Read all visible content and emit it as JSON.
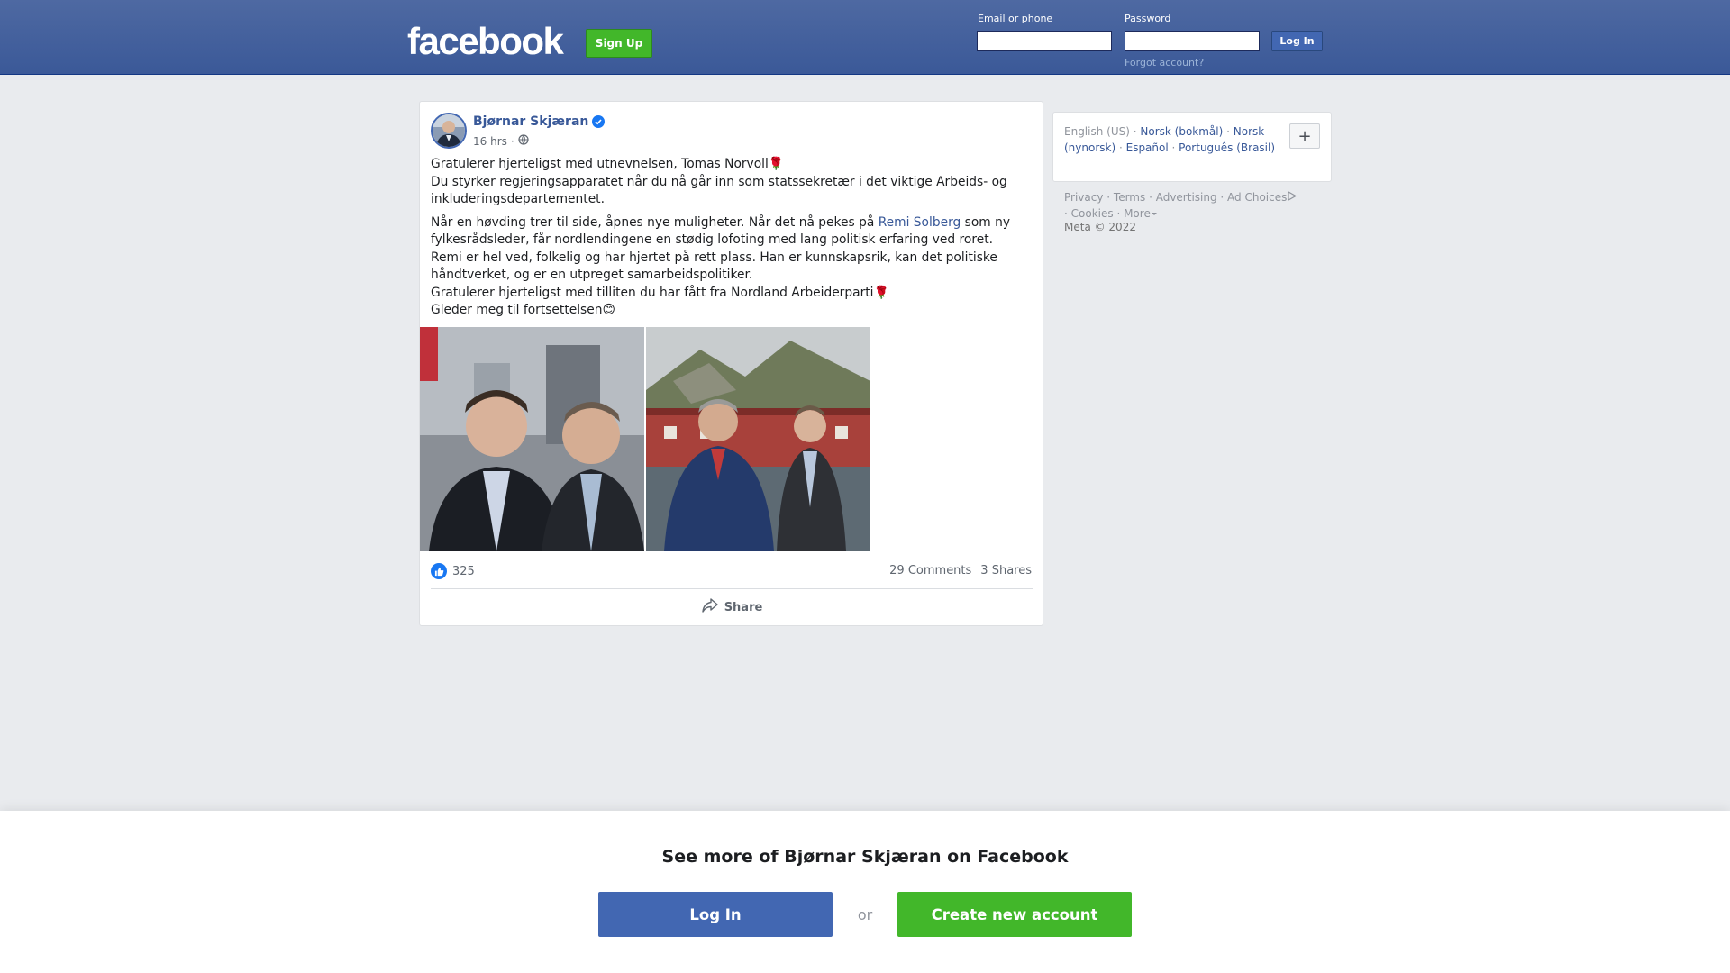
{
  "header": {
    "logo": "facebook",
    "signup_label": "Sign Up",
    "email_label": "Email or phone",
    "password_label": "Password",
    "login_label": "Log In",
    "forgot_label": "Forgot account?"
  },
  "post": {
    "author": "Bjørnar Skjæran",
    "time": "16 hrs",
    "separator": "·",
    "paragraph1": {
      "line1": "Gratulerer hjerteligst med utnevnelsen, Tomas Norvoll🌹",
      "line2": "Du styrker regjeringsapparatet når du nå går inn som statssekretær i det viktige Arbeids- og inkluderingsdepartementet."
    },
    "paragraph2": {
      "before_link": "Når en høvding trer til side, åpnes nye muligheter. Når det nå pekes på ",
      "link": "Remi Solberg",
      "after_link": " som ny fylkesrådsleder, får nordlendingene en stødig lofoting med lang politisk erfaring ved roret.",
      "line2": "Remi er hel ved, folkelig og har hjertet på rett plass. Han er kunnskapsrik, kan det politiske håndtverket, og er en utpreget samarbeidspolitiker.",
      "line3": "Gratulerer hjerteligst med tilliten du har fått fra Nordland Arbeiderparti🌹",
      "line4": "Gleder meg til fortsettelsen😊"
    },
    "reactions_count": "325",
    "comments": "29 Comments",
    "shares": "3 Shares",
    "share_label": "Share"
  },
  "sidebar": {
    "languages": [
      {
        "label": "English (US)",
        "current": true
      },
      {
        "label": "Norsk (bokmål)"
      },
      {
        "label": "Norsk (nynorsk)"
      },
      {
        "label": "Español"
      },
      {
        "label": "Português (Brasil)"
      }
    ],
    "plus_label": "+",
    "footer_links": [
      "Privacy",
      "Terms",
      "Advertising",
      "Ad Choices",
      "Cookies",
      "More"
    ],
    "copyright": "Meta © 2022"
  },
  "bottom": {
    "see_more": "See more of Bjørnar Skjæran on Facebook",
    "login_label": "Log In",
    "or_label": "or",
    "create_label": "Create new account"
  },
  "colors": {
    "brand_blue": "#4267b2",
    "header_blue": "#3b5998",
    "green": "#42b72a",
    "link": "#385898"
  }
}
